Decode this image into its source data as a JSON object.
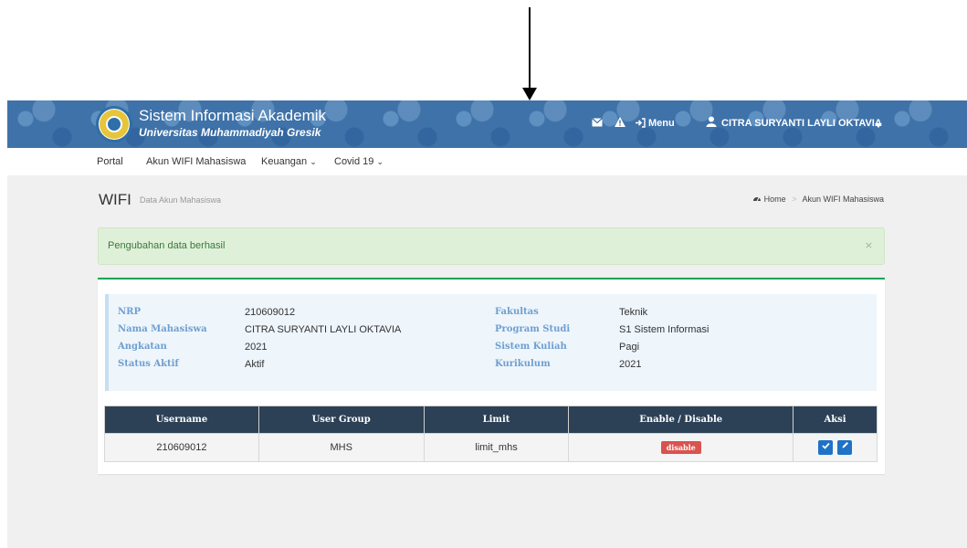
{
  "header": {
    "title": "Sistem Informasi Akademik",
    "subtitle": "Universitas Muhammadiyah Gresik",
    "menu_label": "Menu",
    "user_name": "CITRA SURYANTI LAYLI OKTAVIA",
    "icons": [
      "envelope-icon",
      "warning-icon",
      "sign-in-icon",
      "user-icon",
      "caret-down-icon"
    ]
  },
  "nav": {
    "items": [
      {
        "label": "Portal"
      },
      {
        "label": "Akun WIFI Mahasiswa"
      },
      {
        "label": "Keuangan"
      },
      {
        "label": "Covid 19"
      }
    ]
  },
  "page": {
    "title": "WIFI",
    "subtitle": "Data Akun Mahasiswa",
    "breadcrumb": [
      "Home",
      "Akun WIFI Mahasiswa"
    ]
  },
  "alert": {
    "message": "Pengubahan data berhasil",
    "close": "×"
  },
  "student": {
    "left": [
      {
        "label": "NRP",
        "value": "210609012"
      },
      {
        "label": "Nama Mahasiswa",
        "value": "CITRA SURYANTI LAYLI OKTAVIA"
      },
      {
        "label": "Angkatan",
        "value": "2021"
      },
      {
        "label": "Status Aktif",
        "value": "Aktif"
      }
    ],
    "right": [
      {
        "label": "Fakultas",
        "value": "Teknik"
      },
      {
        "label": "Program Studi",
        "value": "S1 Sistem Informasi"
      },
      {
        "label": "Sistem Kuliah",
        "value": "Pagi"
      },
      {
        "label": "Kurikulum",
        "value": "2021"
      }
    ]
  },
  "table": {
    "headers": [
      "Username",
      "User Group",
      "Limit",
      "Enable / Disable",
      "Aksi"
    ],
    "rows": [
      {
        "username": "210609012",
        "group": "MHS",
        "limit": "limit_mhs",
        "status": "disable"
      }
    ]
  },
  "colors": {
    "header_bg": "#3f72a8",
    "table_header": "#2c4156",
    "alert_bg": "#dff0d8",
    "box_border": "#00a65a",
    "badge_disable": "#d9534f",
    "button": "#1f72c6"
  }
}
